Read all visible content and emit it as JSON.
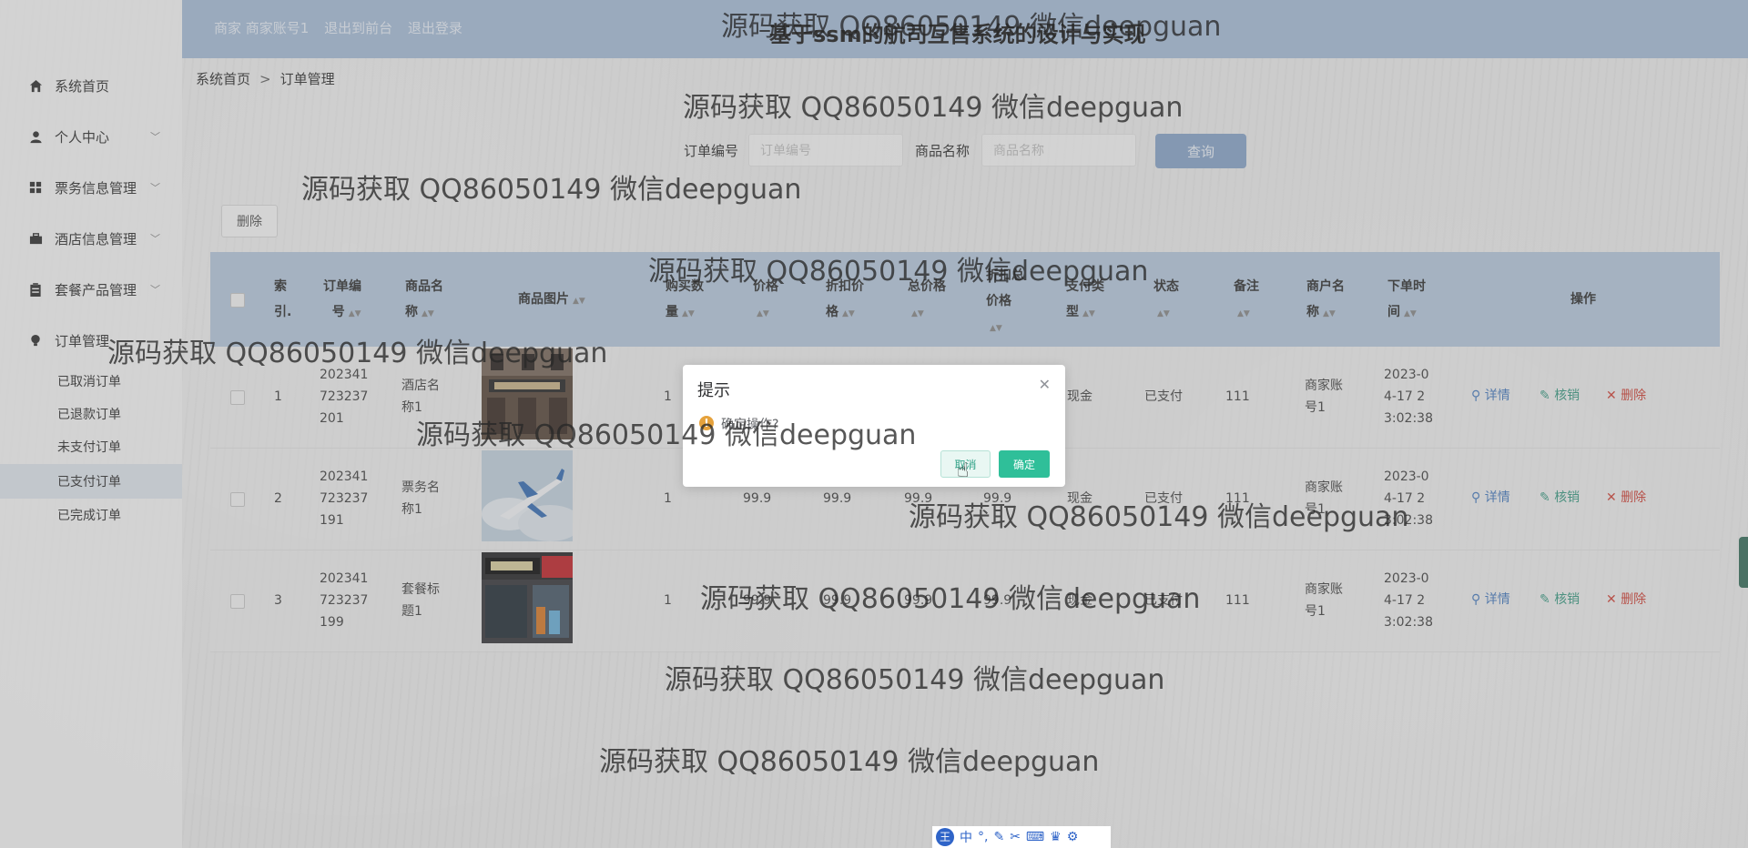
{
  "header": {
    "links": [
      "商家 商家账号1",
      "退出到前台",
      "退出登录"
    ],
    "title": "基于ssm的航司互售系统的设计与实现"
  },
  "sidebar": {
    "items": [
      {
        "label": "系统首页",
        "icon": "home-icon"
      },
      {
        "label": "个人中心",
        "icon": "user-icon"
      },
      {
        "label": "票务信息管理",
        "icon": "grid-icon"
      },
      {
        "label": "酒店信息管理",
        "icon": "briefcase-icon"
      },
      {
        "label": "套餐产品管理",
        "icon": "clipboard-icon"
      },
      {
        "label": "订单管理",
        "icon": "bulb-icon"
      }
    ],
    "sub_items": [
      "已取消订单",
      "已退款订单",
      "未支付订单",
      "已支付订单",
      "已完成订单"
    ],
    "active_sub": "已支付订单"
  },
  "breadcrumb": {
    "home": "系统首页",
    "separator": ">",
    "current": "订单管理"
  },
  "search": {
    "order_no_label": "订单编号",
    "order_no_placeholder": "订单编号",
    "product_name_label": "商品名称",
    "product_name_placeholder": "商品名称",
    "button": "查询"
  },
  "delete_button": "删除",
  "table": {
    "headers": {
      "index": [
        "索",
        "引."
      ],
      "order_no": [
        "订单编",
        "号"
      ],
      "product_name": [
        "商品名",
        "称"
      ],
      "image": "商品图片",
      "quantity": [
        "购买数",
        "量"
      ],
      "price": "价格",
      "discount_price": [
        "折扣价",
        "格"
      ],
      "total": "总价格",
      "discount_total": [
        "折扣总",
        "价格"
      ],
      "pay_type": [
        "支付类",
        "型"
      ],
      "status": "状态",
      "remark": "备注",
      "merchant": [
        "商户名",
        "称"
      ],
      "order_time": [
        "下单时",
        "间"
      ],
      "actions": "操作"
    },
    "rows": [
      {
        "index": "1",
        "order_no": [
          "202341",
          "723237",
          "201"
        ],
        "product_name": [
          "酒店名",
          "称1"
        ],
        "image": "hotel-photo",
        "quantity": "1",
        "price": "",
        "discount_price": "",
        "total": "",
        "discount_total": "",
        "pay_type": "现金",
        "status": "已支付",
        "remark": "111",
        "merchant": [
          "商家账",
          "号1"
        ],
        "order_time": [
          "2023-0",
          "4-17 2",
          "3:02:38"
        ]
      },
      {
        "index": "2",
        "order_no": [
          "202341",
          "723237",
          "191"
        ],
        "product_name": [
          "票务名",
          "称1"
        ],
        "image": "airplane-photo",
        "quantity": "1",
        "price": "99.9",
        "discount_price": "99.9",
        "total": "99.9",
        "discount_total": "99.9",
        "pay_type": "现金",
        "status": "已支付",
        "remark": "111",
        "merchant": [
          "商家账",
          "号1"
        ],
        "order_time": [
          "2023-0",
          "4-17 2",
          "3:02:38"
        ]
      },
      {
        "index": "3",
        "order_no": [
          "202341",
          "723237",
          "199"
        ],
        "product_name": [
          "套餐标",
          "题1"
        ],
        "image": "storefront-photo",
        "quantity": "1",
        "price": "99.9",
        "discount_price": "99.9",
        "total": "99.9",
        "discount_total": "99.9",
        "pay_type": "现金",
        "status": "已支付",
        "remark": "111",
        "merchant": [
          "商家账",
          "号1"
        ],
        "order_time": [
          "2023-0",
          "4-17 2",
          "3:02:38"
        ]
      }
    ],
    "actions": {
      "detail": "详情",
      "verify": "核销",
      "delete": "删除"
    }
  },
  "modal": {
    "title": "提示",
    "message": "确定操作?",
    "cancel": "取消",
    "confirm": "确定"
  },
  "watermark": "源码获取 QQ86050149 微信deepguan",
  "ime": {
    "lang": "中"
  },
  "colors": {
    "header_bg": "#a8bed9",
    "search_btn": "#8aa5c9",
    "confirm_btn": "#2fbf99",
    "delete_red": "#d0453a",
    "detail_blue": "#4a7dbf",
    "verify_green": "#3c9b84"
  }
}
